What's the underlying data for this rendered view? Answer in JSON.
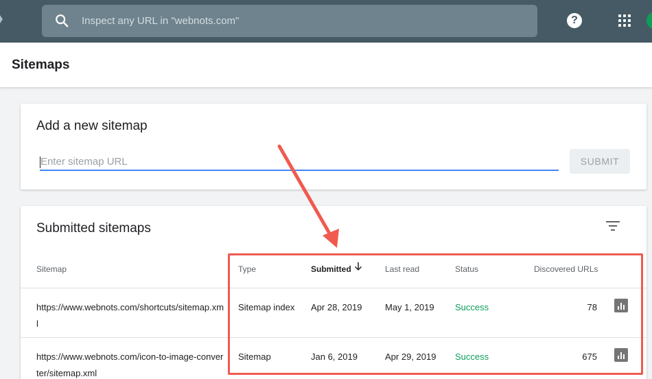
{
  "search": {
    "placeholder": "Inspect any URL in \"webnots.com\""
  },
  "header": {
    "title": "Sitemaps"
  },
  "add_sitemap": {
    "title": "Add a new sitemap",
    "input_placeholder": "Enter sitemap URL",
    "submit_label": "SUBMIT"
  },
  "submitted": {
    "title": "Submitted sitemaps",
    "columns": [
      "Sitemap",
      "Type",
      "Submitted",
      "Last read",
      "Status",
      "Discovered URLs"
    ],
    "rows": [
      {
        "sitemap": "https://www.webnots.com/shortcuts/sitemap.xml",
        "type": "Sitemap index",
        "submitted": "Apr 28, 2019",
        "last_read": "May 1, 2019",
        "status": "Success",
        "urls": "78"
      },
      {
        "sitemap": "https://www.webnots.com/icon-to-image-converter/sitemap.xml",
        "type": "Sitemap",
        "submitted": "Jan 6, 2019",
        "last_read": "Apr 29, 2019",
        "status": "Success",
        "urls": "675"
      }
    ]
  },
  "icons": {
    "search": "search-icon",
    "help": "help-icon",
    "apps": "apps-grid-icon",
    "filter": "filter-icon",
    "sort": "arrow-down-icon",
    "chart": "bar-chart-icon"
  },
  "colors": {
    "topbar": "#455a64",
    "accent": "#4285f4",
    "success": "#0f9d58",
    "annotation": "#f05a4f"
  }
}
